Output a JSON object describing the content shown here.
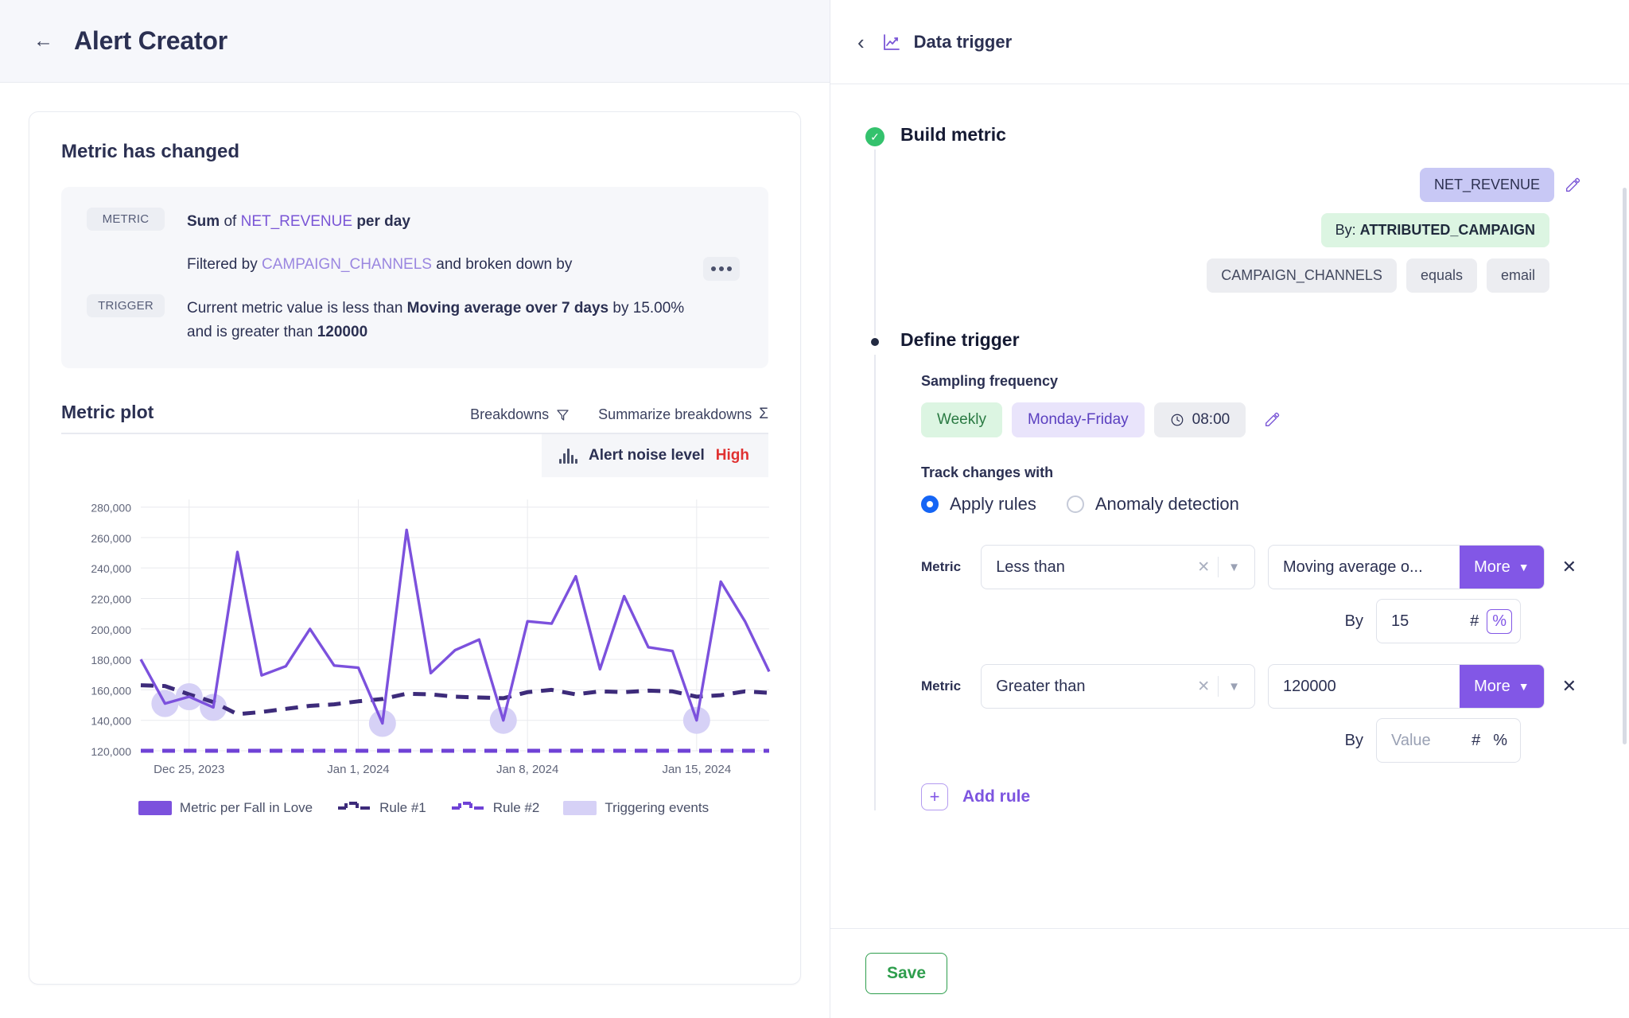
{
  "header": {
    "back_icon": "arrow-left-icon",
    "title": "Alert Creator"
  },
  "left_card": {
    "title": "Metric has changed",
    "metric_tag": "METRIC",
    "trigger_tag": "TRIGGER",
    "metric_line1": {
      "pre": "Sum",
      "mid": "of",
      "field": "NET_REVENUE",
      "post": "per day"
    },
    "metric_line2": {
      "pre": "Filtered by",
      "field": "CAMPAIGN_CHANNELS",
      "post": "and broken down by"
    },
    "trigger_line1": {
      "pre": "Current metric value is less than",
      "strong": "Moving average over 7 days",
      "post": "by 15.00%"
    },
    "trigger_line2": {
      "pre": "and is greater than",
      "strong": "120000"
    },
    "more_icon": "ellipsis-icon"
  },
  "plot": {
    "title": "Metric plot",
    "breakdowns_label": "Breakdowns",
    "breakdowns_icon": "filter-icon",
    "summarize_label": "Summarize breakdowns",
    "summarize_icon": "sigma-icon",
    "noise_icon": "waveform-icon",
    "noise_label": "Alert noise level",
    "noise_value": "High"
  },
  "chart_data": {
    "type": "line",
    "title": "Metric plot",
    "xlabel": "",
    "ylabel": "",
    "ylim": [
      120000,
      285000
    ],
    "yticks": [
      120000,
      140000,
      160000,
      180000,
      200000,
      220000,
      240000,
      260000,
      280000
    ],
    "ytick_labels": [
      "120,000",
      "140,000",
      "160,000",
      "180,000",
      "200,000",
      "220,000",
      "240,000",
      "260,000",
      "280,000"
    ],
    "xtick_labels": [
      "Dec 25, 2023",
      "Jan 1, 2024",
      "Jan 8, 2024",
      "Jan 15, 2024"
    ],
    "xtick_index": [
      2,
      9,
      16,
      23
    ],
    "grid": true,
    "legend_position": "bottom",
    "series": [
      {
        "name": "Metric per Fall in Love",
        "color": "#7c51dd",
        "style": "solid",
        "values": [
          180000,
          151000,
          155500,
          148500,
          250500,
          169500,
          175500,
          200000,
          176000,
          174500,
          138000,
          265000,
          171000,
          186000,
          193000,
          140000,
          205000,
          203500,
          234500,
          173500,
          221500,
          188000,
          185500,
          140000,
          231000,
          205000,
          172000
        ]
      },
      {
        "name": "Rule #1",
        "color": "#3d2b7a",
        "style": "dashed",
        "values": [
          163000,
          162500,
          157000,
          152000,
          144000,
          145500,
          147500,
          149500,
          150500,
          152500,
          154000,
          157500,
          157000,
          155500,
          155000,
          154500,
          158500,
          160000,
          157000,
          159000,
          158500,
          159500,
          159000,
          155500,
          156500,
          159000,
          158000
        ]
      },
      {
        "name": "Rule #2",
        "color": "#6f42d6",
        "style": "dashed",
        "values": [
          120000,
          120000,
          120000,
          120000,
          120000,
          120000,
          120000,
          120000,
          120000,
          120000,
          120000,
          120000,
          120000,
          120000,
          120000,
          120000,
          120000,
          120000,
          120000,
          120000,
          120000,
          120000,
          120000,
          120000,
          120000,
          120000,
          120000
        ]
      }
    ],
    "triggering_events": {
      "name": "Triggering events",
      "color": "#d6d1f6",
      "indices": [
        1,
        2,
        3,
        10,
        15,
        23
      ]
    },
    "legend": [
      {
        "label": "Metric per Fall in Love",
        "type": "solid-swatch",
        "color": "#7c51dd"
      },
      {
        "label": "Rule #1",
        "type": "dashed",
        "color": "#3d2b7a"
      },
      {
        "label": "Rule #2",
        "type": "dashed",
        "color": "#6f42d6"
      },
      {
        "label": "Triggering events",
        "type": "solid-swatch",
        "color": "#d6d1f6"
      }
    ]
  },
  "right": {
    "back_icon": "chevron-left-icon",
    "panel_icon": "chart-line-icon",
    "panel_title": "Data trigger",
    "build_metric": {
      "title": "Build metric",
      "status_icon": "check-circle-icon",
      "metric_chip": "NET_REVENUE",
      "edit_icon": "edit-icon",
      "breakdown_chip_prefix": "By: ",
      "breakdown_chip_value": "ATTRIBUTED_CAMPAIGN",
      "filter_chips": [
        "CAMPAIGN_CHANNELS",
        "equals",
        "email"
      ]
    },
    "define_trigger": {
      "title": "Define trigger",
      "sampling_label": "Sampling frequency",
      "frequency": "Weekly",
      "days": "Monday-Friday",
      "clock_icon": "clock-icon",
      "time": "08:00",
      "edit_icon": "edit-icon",
      "track_label": "Track changes with",
      "radio_apply": "Apply rules",
      "radio_anomaly": "Anomaly detection",
      "rules": [
        {
          "metric_label": "Metric",
          "operator": "Less than",
          "clear_icon": "close-icon",
          "chevron_icon": "chevron-down-icon",
          "target_value": "Moving average o...",
          "more_label": "More",
          "remove_icon": "close-icon",
          "by_label": "By",
          "by_value": "15",
          "by_placeholder": "",
          "unit_hash": "#",
          "unit_percent": "%",
          "unit_selected": "percent"
        },
        {
          "metric_label": "Metric",
          "operator": "Greater than",
          "clear_icon": "close-icon",
          "chevron_icon": "chevron-down-icon",
          "target_value": "120000",
          "more_label": "More",
          "remove_icon": "close-icon",
          "by_label": "By",
          "by_value": "",
          "by_placeholder": "Value",
          "unit_hash": "#",
          "unit_percent": "%",
          "unit_selected": "none"
        }
      ],
      "add_rule_label": "Add rule",
      "add_rule_icon": "plus-icon"
    },
    "save_label": "Save"
  },
  "colors": {
    "accent_purple": "#7a56d6",
    "more_purple": "#8257e6",
    "green": "#2e9e4d",
    "red": "#e03131",
    "radio_blue": "#1565f5"
  }
}
